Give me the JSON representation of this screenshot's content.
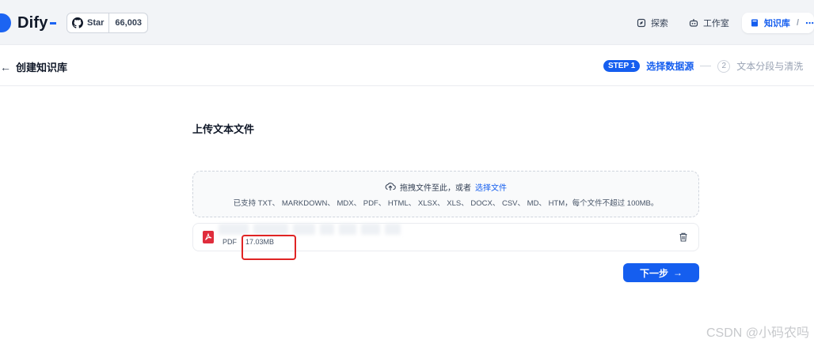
{
  "brand": {
    "name": "Dify",
    "accent": "#155eef"
  },
  "github": {
    "label": "Star",
    "count": "66,003"
  },
  "nav": {
    "items": [
      {
        "label": "探索",
        "icon": "compass-icon"
      },
      {
        "label": "工作室",
        "icon": "robot-icon"
      },
      {
        "label": "知识库",
        "icon": "book-icon",
        "active": true
      }
    ],
    "separator": "/"
  },
  "header": {
    "title": "创建知识库"
  },
  "steps": {
    "step1_badge": "STEP 1",
    "step1_label": "选择数据源",
    "step2_num": "2",
    "step2_label": "文本分段与清洗"
  },
  "upload": {
    "title": "上传文本文件",
    "drop_text": "拖拽文件至此，或者",
    "select_link": "选择文件",
    "supported": "已支持 TXT、 MARKDOWN、 MDX、 PDF、 HTML、 XLSX、 XLS、 DOCX、 CSV、 MD、 HTM，每个文件不超过 100MB。"
  },
  "file": {
    "type": "PDF",
    "size": "17.03MB"
  },
  "actions": {
    "next_label": "下一步",
    "next_arrow": "→"
  },
  "watermark": "CSDN @小码农吗"
}
